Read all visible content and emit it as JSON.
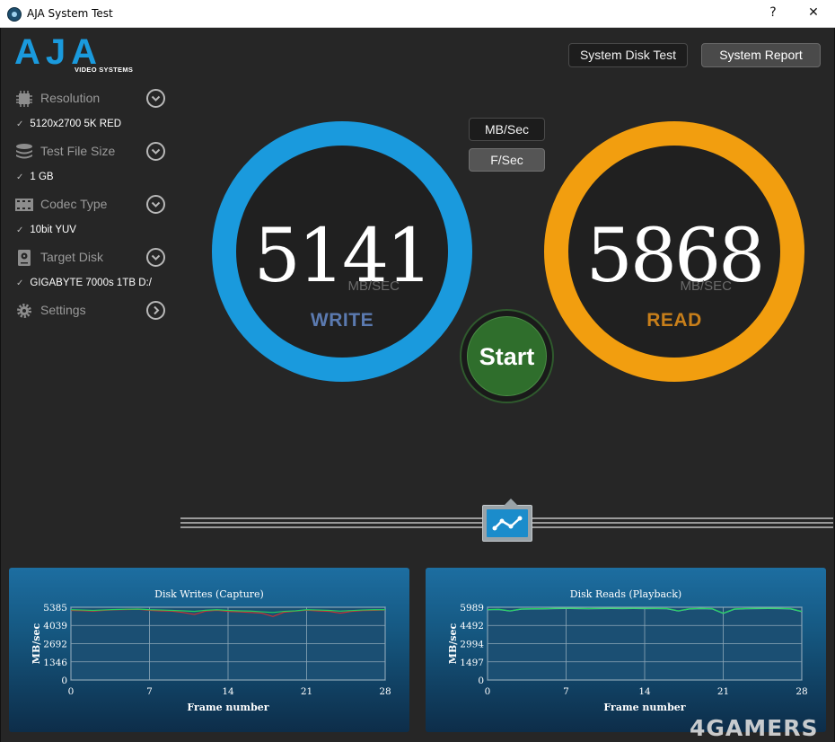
{
  "window": {
    "title": "AJA System Test",
    "help_label": "?",
    "close_label": "✕"
  },
  "logo": {
    "text": "AJA",
    "subtitle": "VIDEO SYSTEMS",
    "color": "#1a9add"
  },
  "toolbar": {
    "disk_test_label": "System Disk Test",
    "report_label": "System Report"
  },
  "sidebar": {
    "items": [
      {
        "label": "Resolution",
        "value": "5120x2700 5K RED",
        "icon": "chip-icon",
        "toggle": "chevron-down-icon"
      },
      {
        "label": "Test File Size",
        "value": "1 GB",
        "icon": "stack-icon",
        "toggle": "chevron-down-icon"
      },
      {
        "label": "Codec Type",
        "value": "10bit YUV",
        "icon": "film-icon",
        "toggle": "chevron-down-icon"
      },
      {
        "label": "Target Disk",
        "value": "GIGABYTE 7000s 1TB D:/",
        "icon": "disk-icon",
        "toggle": "chevron-down-icon"
      },
      {
        "label": "Settings",
        "icon": "gear-icon",
        "toggle": "chevron-right-icon"
      }
    ],
    "check_glyph": "✓"
  },
  "units": {
    "mb_label": "MB/Sec",
    "f_label": "F/Sec"
  },
  "write": {
    "value": "5141",
    "unit": "MB/SEC",
    "label": "WRITE",
    "color": "#1a9add"
  },
  "read": {
    "value": "5868",
    "unit": "MB/SEC",
    "label": "READ",
    "color": "#f29e0f"
  },
  "start": {
    "label": "Start",
    "color": "#2f6e2c"
  },
  "watermark": "4GAMERS",
  "chart_data": [
    {
      "type": "line",
      "title": "Disk Writes (Capture)",
      "xlabel": "Frame number",
      "ylabel": "MB/sec",
      "xticks": [
        0,
        7,
        14,
        21,
        28
      ],
      "yticks": [
        0,
        1346,
        2692,
        4039,
        5385
      ],
      "xlim": [
        0,
        28
      ],
      "ylim": [
        0,
        5385
      ],
      "grid": true,
      "series": [
        {
          "color": "#22d060",
          "x": [
            0,
            1,
            2,
            3,
            4,
            5,
            6,
            7,
            8,
            9,
            10,
            11,
            12,
            13,
            14,
            15,
            16,
            17,
            18,
            19,
            20,
            21,
            22,
            23,
            24,
            25,
            26,
            27,
            28
          ],
          "values": [
            5200,
            5180,
            5150,
            5190,
            5220,
            5240,
            5250,
            5200,
            5180,
            5150,
            5120,
            5080,
            5160,
            5200,
            5150,
            5120,
            5100,
            5050,
            5000,
            5080,
            5120,
            5200,
            5180,
            5150,
            5100,
            5140,
            5180,
            5200,
            5200
          ]
        },
        {
          "color": "#d03030",
          "x": [
            0,
            1,
            2,
            3,
            4,
            5,
            6,
            7,
            8,
            9,
            10,
            11,
            12,
            13,
            14,
            15,
            16,
            17,
            18,
            19,
            20,
            21,
            22,
            23,
            24,
            25,
            26,
            27,
            28
          ],
          "values": [
            5150,
            5130,
            5100,
            5160,
            5200,
            5220,
            5230,
            5160,
            5120,
            5100,
            5000,
            4850,
            5100,
            5160,
            5080,
            5050,
            5000,
            4950,
            4700,
            5020,
            5100,
            5170,
            5120,
            5080,
            4950,
            5080,
            5140,
            5160,
            5180
          ]
        }
      ]
    },
    {
      "type": "line",
      "title": "Disk Reads (Playback)",
      "xlabel": "Frame number",
      "ylabel": "MB/sec",
      "xticks": [
        0,
        7,
        14,
        21,
        28
      ],
      "yticks": [
        0,
        1497,
        2994,
        4492,
        5989
      ],
      "xlim": [
        0,
        28
      ],
      "ylim": [
        0,
        5989
      ],
      "grid": true,
      "series": [
        {
          "color": "#22d060",
          "x": [
            0,
            1,
            2,
            3,
            4,
            5,
            6,
            7,
            8,
            9,
            10,
            11,
            12,
            13,
            14,
            15,
            16,
            17,
            18,
            19,
            20,
            21,
            22,
            23,
            24,
            25,
            26,
            27,
            28
          ],
          "values": [
            5800,
            5820,
            5700,
            5850,
            5870,
            5880,
            5900,
            5910,
            5900,
            5890,
            5900,
            5910,
            5900,
            5905,
            5900,
            5895,
            5890,
            5700,
            5870,
            5900,
            5880,
            5500,
            5850,
            5890,
            5900,
            5905,
            5900,
            5880,
            5650
          ]
        },
        {
          "color": "#7fd8c0",
          "x": [
            0,
            1,
            2,
            3,
            4,
            5,
            6,
            7,
            8,
            9,
            10,
            11,
            12,
            13,
            14,
            15,
            16,
            17,
            18,
            19,
            20,
            21,
            22,
            23,
            24,
            25,
            26,
            27,
            28
          ],
          "values": [
            5780,
            5800,
            5680,
            5830,
            5850,
            5860,
            5880,
            5890,
            5880,
            5870,
            5880,
            5890,
            5880,
            5885,
            5880,
            5875,
            5870,
            5680,
            5850,
            5880,
            5860,
            5480,
            5830,
            5870,
            5880,
            5885,
            5880,
            5860,
            5630
          ]
        }
      ]
    }
  ]
}
